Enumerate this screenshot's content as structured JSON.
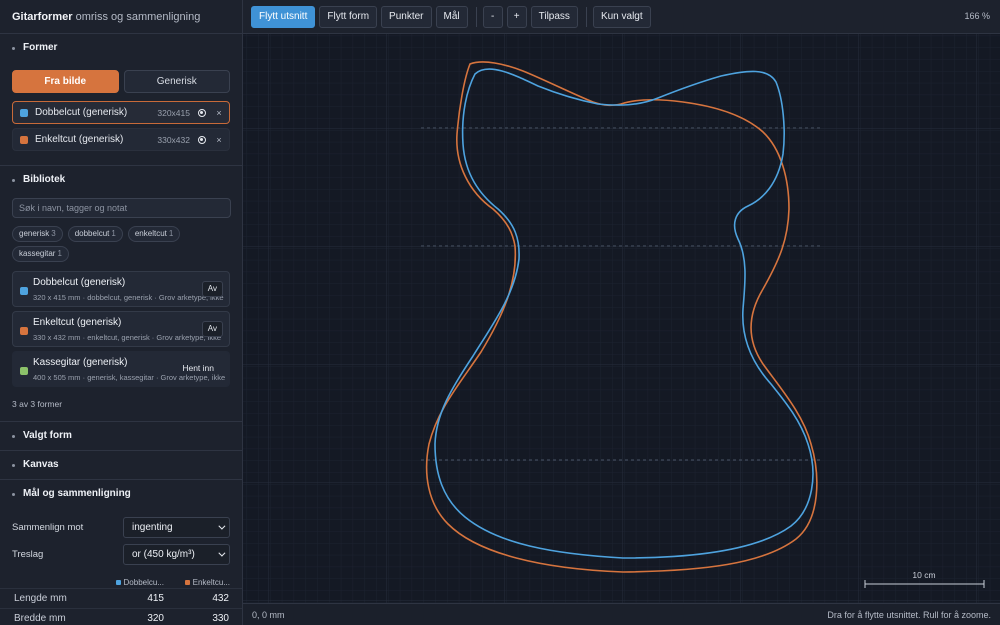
{
  "app": {
    "title_bold": "Gitarformer",
    "title_rest": "omriss og sammenligning"
  },
  "colors": {
    "blue": "#4ea3df",
    "orange": "#d6743e",
    "green": "#8cc26a",
    "accent": "#3f92d6"
  },
  "sections": {
    "former": {
      "title": "Former",
      "seg_from_image": "Fra bilde",
      "seg_generic": "Generisk",
      "shapes": [
        {
          "name": "Dobbelcut (generisk)",
          "size": "320x415",
          "color": "#4ea3df"
        },
        {
          "name": "Enkeltcut (generisk)",
          "size": "330x432",
          "color": "#d6743e"
        }
      ],
      "remove_symbol": "×"
    },
    "bibliotek": {
      "title": "Bibliotek",
      "search_placeholder": "Søk i navn, tagger og notat",
      "tags": [
        {
          "label": "generisk",
          "count": "3"
        },
        {
          "label": "dobbelcut",
          "count": "1"
        },
        {
          "label": "enkeltcut",
          "count": "1"
        },
        {
          "label": "kassegitar",
          "count": "1"
        }
      ],
      "items": [
        {
          "title": "Dobbelcut (generisk)",
          "meta": "320 x 415 mm · dobbelcut, generisk · Grov arketype, ikke",
          "color": "#4ea3df",
          "action": "Av"
        },
        {
          "title": "Enkeltcut (generisk)",
          "meta": "330 x 432 mm · enkeltcut, generisk · Grov arketype, ikke",
          "color": "#d6743e",
          "action": "Av"
        },
        {
          "title": "Kassegitar (generisk)",
          "meta": "400 x 505 mm · generisk, kassegitar · Grov arketype, ikke",
          "color": "#8cc26a",
          "action": "Hent inn"
        }
      ],
      "count_text": "3 av 3 former"
    },
    "valgt_form": {
      "title": "Valgt form"
    },
    "kanvas": {
      "title": "Kanvas"
    },
    "maal": {
      "title": "Mål og sammenligning",
      "compare_label": "Sammenlign mot",
      "compare_value": "ingenting",
      "wood_label": "Treslag",
      "wood_value": "or (450 kg/m³)",
      "col_a": "Dobbelcu...",
      "col_b": "Enkeltcu...",
      "rows": [
        {
          "label": "Lengde mm",
          "a": "415",
          "b": "432"
        },
        {
          "label": "Bredde mm",
          "a": "320",
          "b": "330"
        }
      ]
    }
  },
  "toolbar": {
    "move_view": "Flytt utsnitt",
    "move_shape": "Flytt form",
    "points": "Punkter",
    "measure": "Mål",
    "zoom_out": "-",
    "zoom_in": "+",
    "fit": "Tilpass",
    "only_selected": "Kun valgt",
    "zoom_level": "166 %"
  },
  "canvas": {
    "scale_label": "10 cm"
  },
  "status": {
    "coords": "0, 0 mm",
    "hint": "Dra for å flytte utsnittet. Rull for å zoome."
  }
}
